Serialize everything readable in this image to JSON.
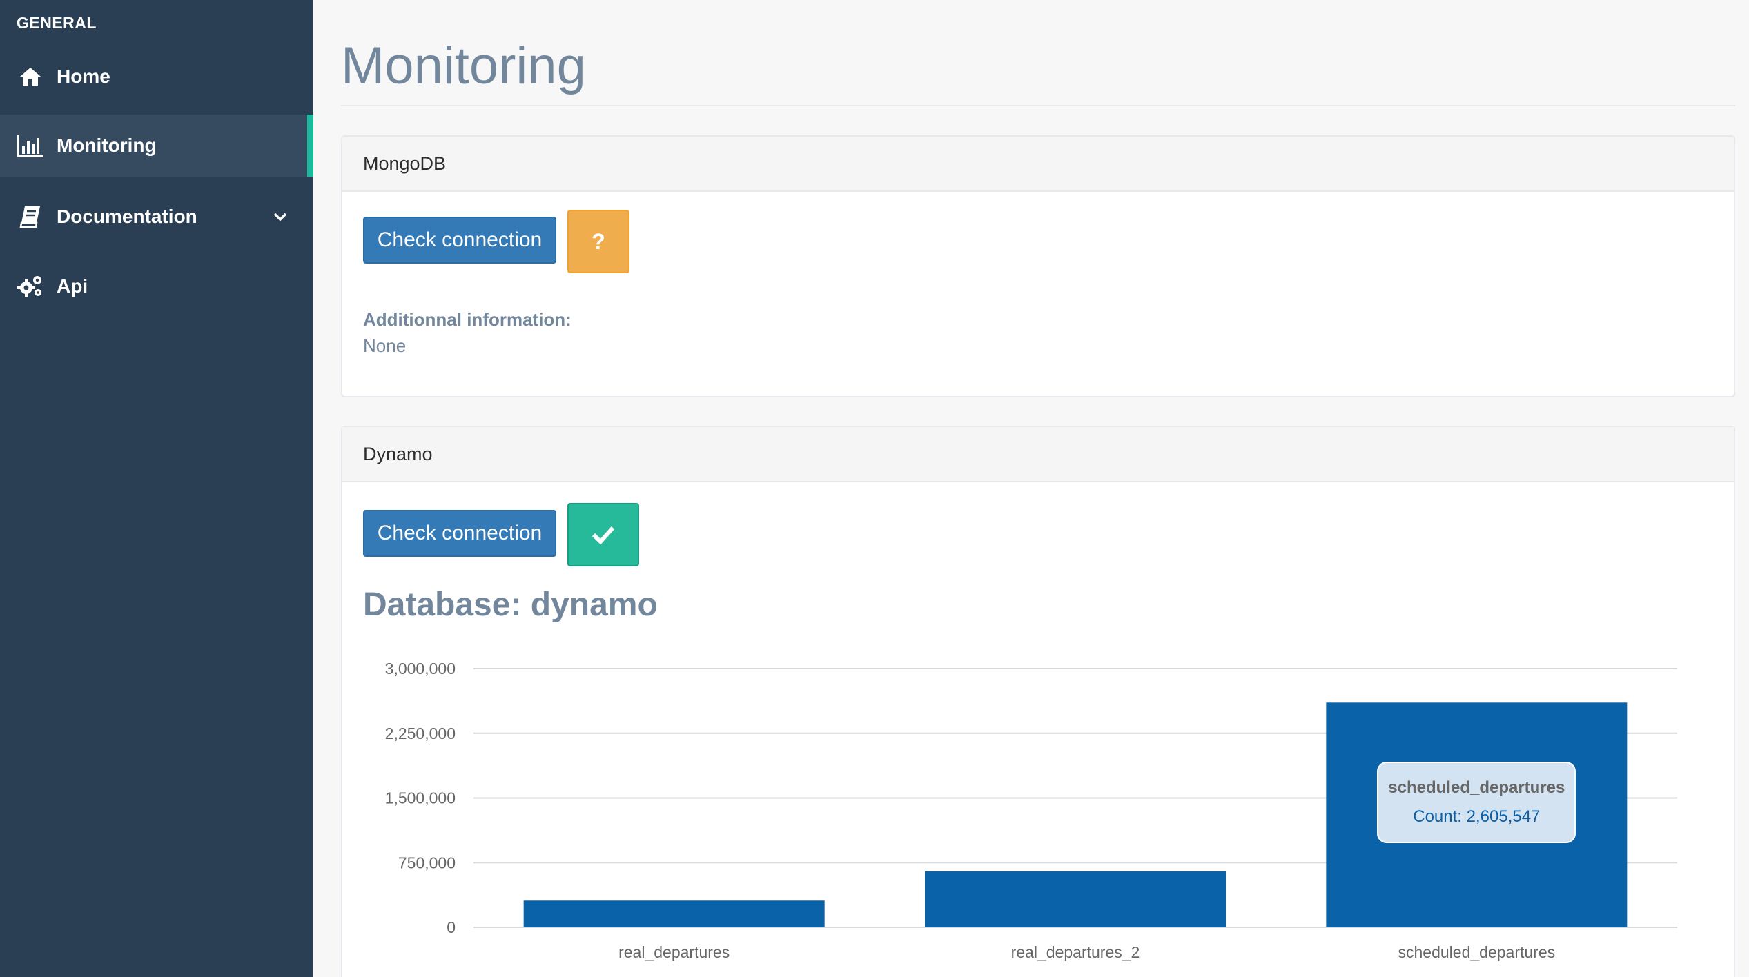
{
  "sidebar": {
    "heading": "GENERAL",
    "items": [
      {
        "label": "Home",
        "icon": "home-icon"
      },
      {
        "label": "Monitoring",
        "icon": "bar-chart-icon",
        "active": true
      },
      {
        "label": "Documentation",
        "icon": "book-icon",
        "has_submenu": true
      },
      {
        "label": "Api",
        "icon": "gears-icon"
      }
    ]
  },
  "page": {
    "title": "Monitoring"
  },
  "mongodb": {
    "header": "MongoDB",
    "check_label": "Check connection",
    "status_symbol": "?",
    "status": "unknown",
    "info_label": "Additionnal information:",
    "info_value": "None"
  },
  "dynamo": {
    "header": "Dynamo",
    "check_label": "Check connection",
    "status": "ok",
    "database_title": "Database: dynamo"
  },
  "colors": {
    "sidebar_bg": "#2a3f54",
    "accent": "#1abb9c",
    "button_primary": "#337ab7",
    "status_warning": "#f0ad4e",
    "status_success": "#26b99a",
    "bar_color": "#0a62a8"
  },
  "chart_data": {
    "type": "bar",
    "categories": [
      "real_departures",
      "real_departures_2",
      "scheduled_departures"
    ],
    "series": [
      {
        "name": "Count",
        "values": [
          310000,
          650000,
          2605547
        ]
      }
    ],
    "ylim": [
      0,
      3000000
    ],
    "yticks": [
      "0",
      "750,000",
      "1,500,000",
      "2,250,000",
      "3,000,000"
    ],
    "ytick_values": [
      0,
      750000,
      1500000,
      2250000,
      3000000
    ],
    "grid": true,
    "tooltip": {
      "category": "scheduled_departures",
      "text": "Count: 2,605,547"
    }
  }
}
